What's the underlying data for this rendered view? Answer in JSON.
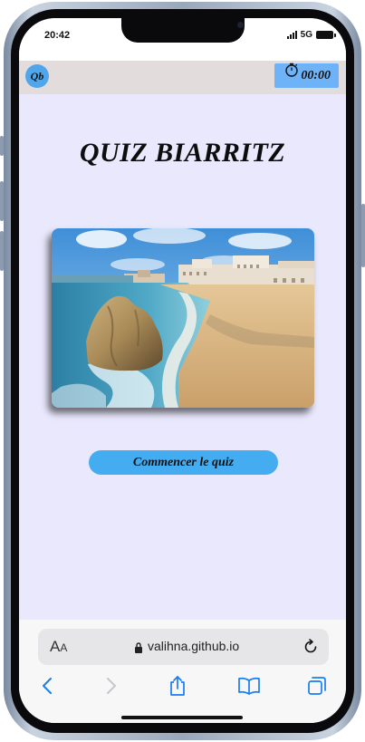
{
  "status_bar": {
    "time": "20:42",
    "network": "5G"
  },
  "header": {
    "logo_text": "Qb",
    "timer_text": "00:00",
    "timer_icon": "stopwatch-icon"
  },
  "main": {
    "title": "QUIZ BIARRITZ",
    "image_alt": "Biarritz beach photo",
    "start_button": "Commencer le quiz"
  },
  "browser": {
    "text_size_big": "A",
    "text_size_small": "A",
    "url": "valihna.github.io",
    "icons": [
      "lock-icon",
      "reload-icon",
      "back-icon",
      "forward-icon",
      "share-icon",
      "bookmarks-icon",
      "tabs-icon"
    ]
  },
  "colors": {
    "header_bg": "#e2dcdc",
    "page_bg": "#e9e8fd",
    "accent": "#44adf1",
    "timer_bg": "#6eb2f7",
    "safari_blue": "#1a7cf2"
  }
}
